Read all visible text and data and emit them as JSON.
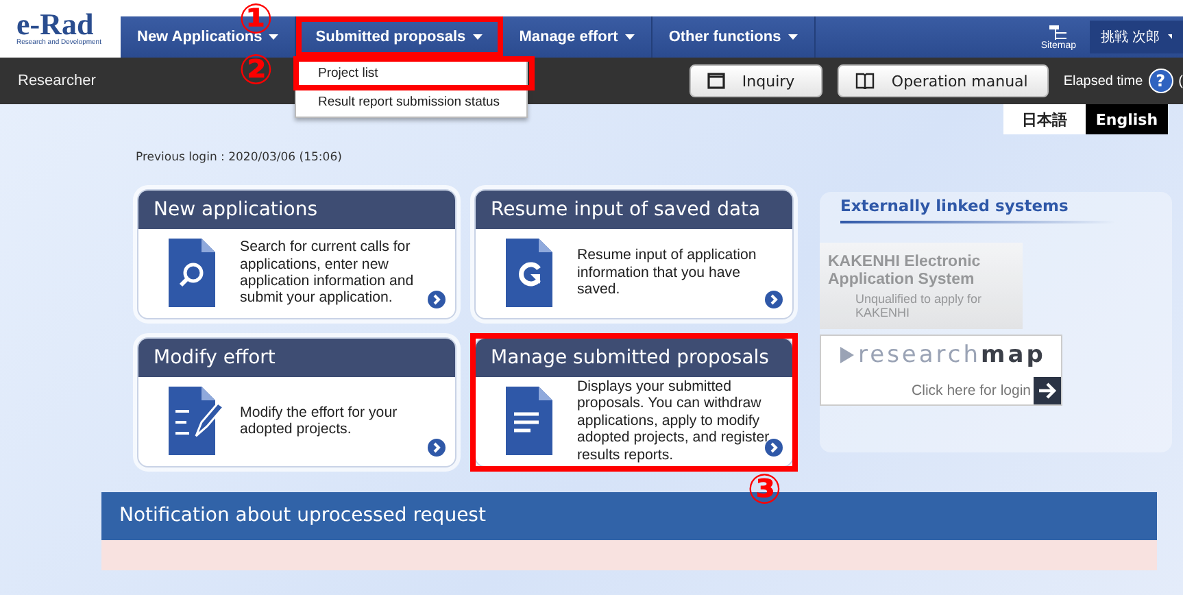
{
  "logo": {
    "title": "e-Rad",
    "subtitle": "Research and Development"
  },
  "nav": {
    "items": [
      {
        "label": "New Applications",
        "highlighted": false
      },
      {
        "label": "Submitted proposals",
        "highlighted": true
      },
      {
        "label": "Manage effort",
        "highlighted": false
      },
      {
        "label": "Other functions",
        "highlighted": false
      }
    ],
    "sitemap": "Sitemap",
    "user": "挑戦 次郎"
  },
  "subbar": {
    "role": "Researcher",
    "buttons": [
      {
        "label": "Inquiry",
        "kind": "window"
      },
      {
        "label": "Operation manual",
        "kind": "book"
      }
    ],
    "elapsed": "Elapsed time",
    "help": "?",
    "elapsed_value": "("
  },
  "dropdown": [
    {
      "label": "Project list",
      "highlighted": true
    },
    {
      "label": "Result report submission status",
      "highlighted": false
    }
  ],
  "languages": [
    {
      "label": "日本語",
      "selected": false
    },
    {
      "label": "English",
      "selected": true
    }
  ],
  "previous_login": "Previous login : 2020/03/06 (15:06)",
  "cards": [
    {
      "title": "New applications",
      "description": "Search for current calls for applications, enter new application information and submit your application.",
      "kind": "search",
      "highlighted": false
    },
    {
      "title": "Resume input of saved data",
      "description": "Resume input of application information that you have saved.",
      "kind": "resume",
      "highlighted": false
    },
    {
      "title": "Modify effort",
      "description": "Modify the effort for your adopted projects.",
      "kind": "edit",
      "highlighted": false
    },
    {
      "title": "Manage submitted proposals",
      "description": "Displays your submitted proposals. You can withdraw applications, apply to modify adopted projects, and register results reports.",
      "kind": "document",
      "highlighted": true
    }
  ],
  "external": {
    "title": "Externally linked systems",
    "kakenhi": {
      "title": "KAKENHI Electronic Application System",
      "note": "Unqualified to apply for KAKENHI",
      "disabled": true
    },
    "researchmap": {
      "logo_light": "research",
      "logo_bold": "map",
      "link": "Click here for login"
    }
  },
  "notification": {
    "title": "Notification about uprocessed request"
  },
  "annotations": [
    {
      "label": "①"
    },
    {
      "label": "②"
    },
    {
      "label": "③"
    }
  ]
}
